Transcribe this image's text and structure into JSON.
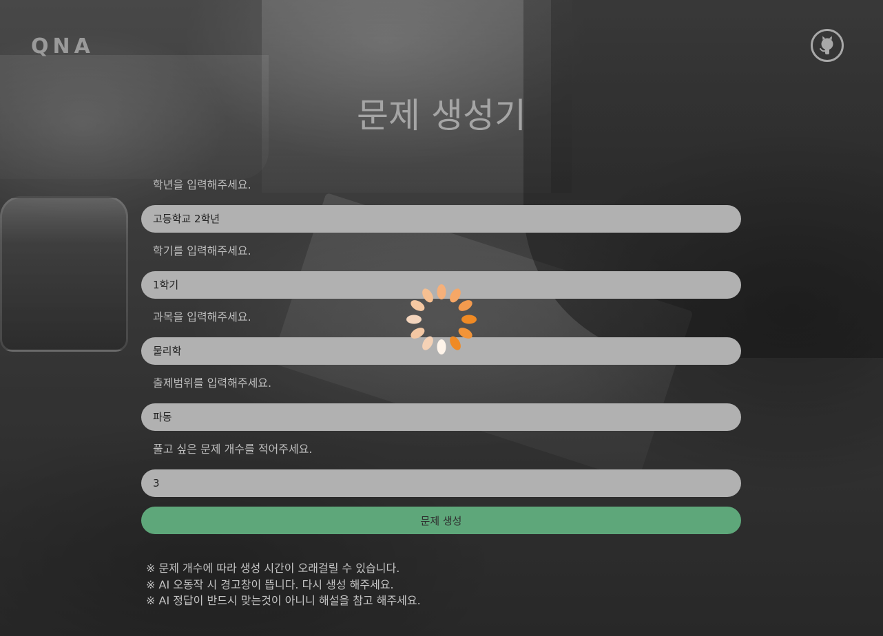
{
  "header": {
    "logo": "QNA",
    "github_icon": "github-icon"
  },
  "main": {
    "title": "문제 생성기"
  },
  "form": {
    "fields": [
      {
        "label": "학년을 입력해주세요.",
        "value": "고등학교 2학년"
      },
      {
        "label": "학기를 입력해주세요.",
        "value": "1학기"
      },
      {
        "label": "과목을 입력해주세요.",
        "value": "물리학"
      },
      {
        "label": "출제범위를 입력해주세요.",
        "value": "파동"
      },
      {
        "label": "풀고 싶은 문제 개수를 적어주세요.",
        "value": "3"
      }
    ],
    "submit_label": "문제 생성"
  },
  "notes": [
    "※ 문제 개수에 따라 생성 시간이 오래걸릴 수 있습니다.",
    "※ AI 오동작 시 경고창이 뜹니다. 다시 생성 해주세요.",
    "※ AI 정답이 반드시 맞는것이 아니니 해설을 참고 해주세요."
  ],
  "loading": {
    "icon": "loading-spinner-icon",
    "accent_color": "#f08a24"
  },
  "colors": {
    "field_bg": "#b1b1b1",
    "button_bg": "#5ea77a"
  }
}
